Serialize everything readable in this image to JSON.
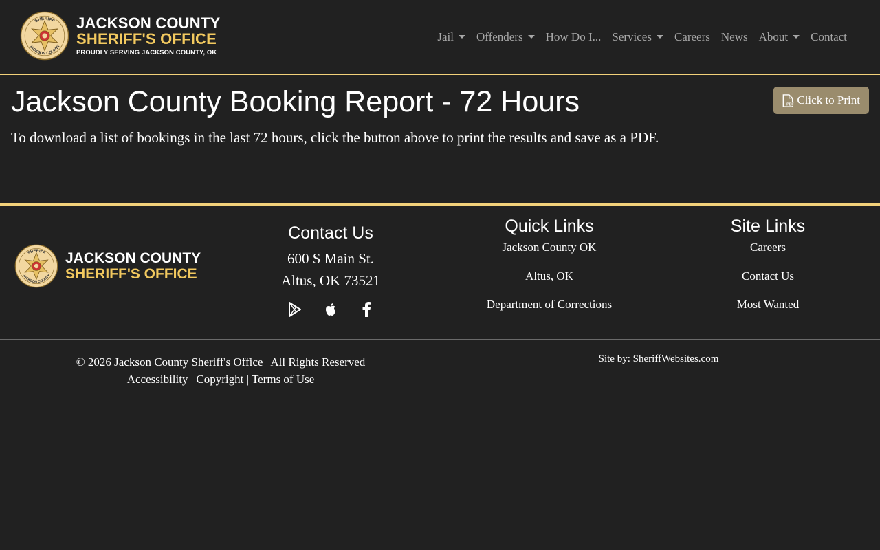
{
  "header": {
    "brand_line1": "JACKSON COUNTY",
    "brand_line2": "SHERIFF'S OFFICE",
    "brand_tagline": "PROUDLY SERVING JACKSON COUNTY, OK",
    "seal_top_text": "SHERIFF",
    "seal_bottom_text": "JACKSON COUNTY",
    "nav": [
      {
        "label": "Jail",
        "dropdown": true
      },
      {
        "label": "Offenders",
        "dropdown": true
      },
      {
        "label": "How Do I...",
        "dropdown": false
      },
      {
        "label": "Services",
        "dropdown": true
      },
      {
        "label": "Careers",
        "dropdown": false
      },
      {
        "label": "News",
        "dropdown": false
      },
      {
        "label": "About",
        "dropdown": true
      },
      {
        "label": "Contact",
        "dropdown": false
      }
    ]
  },
  "main": {
    "title": "Jackson County Booking Report - 72 Hours",
    "print_button": "Click to Print",
    "intro": "To download a list of bookings in the last 72 hours, click the button above to print the results and save as a PDF."
  },
  "footer": {
    "brand_line1": "JACKSON COUNTY",
    "brand_line2": "SHERIFF'S OFFICE",
    "contact": {
      "heading": "Contact Us",
      "address_line1": "600 S Main St.",
      "address_line2": "Altus, OK 73521",
      "social": [
        "google-play-icon",
        "apple-icon",
        "facebook-icon"
      ]
    },
    "quick_links": {
      "heading": "Quick Links",
      "items": [
        "Jackson County OK",
        "Altus, OK",
        "Department of Corrections"
      ]
    },
    "site_links": {
      "heading": "Site Links",
      "items": [
        "Careers",
        "Contact Us",
        "Most Wanted"
      ]
    },
    "copyright": "© 2026 Jackson County Sheriff's Office | All Rights Reserved",
    "legal": [
      "Accessibility",
      "Copyright",
      "Terms of Use"
    ],
    "site_by": "Site by: SheriffWebsites.com"
  },
  "colors": {
    "background": "#212121",
    "accent_gold": "#f2d17a",
    "brand_gold": "#f2c95f",
    "button": "#9a8c6d",
    "nav_text": "#a7a7a7"
  }
}
